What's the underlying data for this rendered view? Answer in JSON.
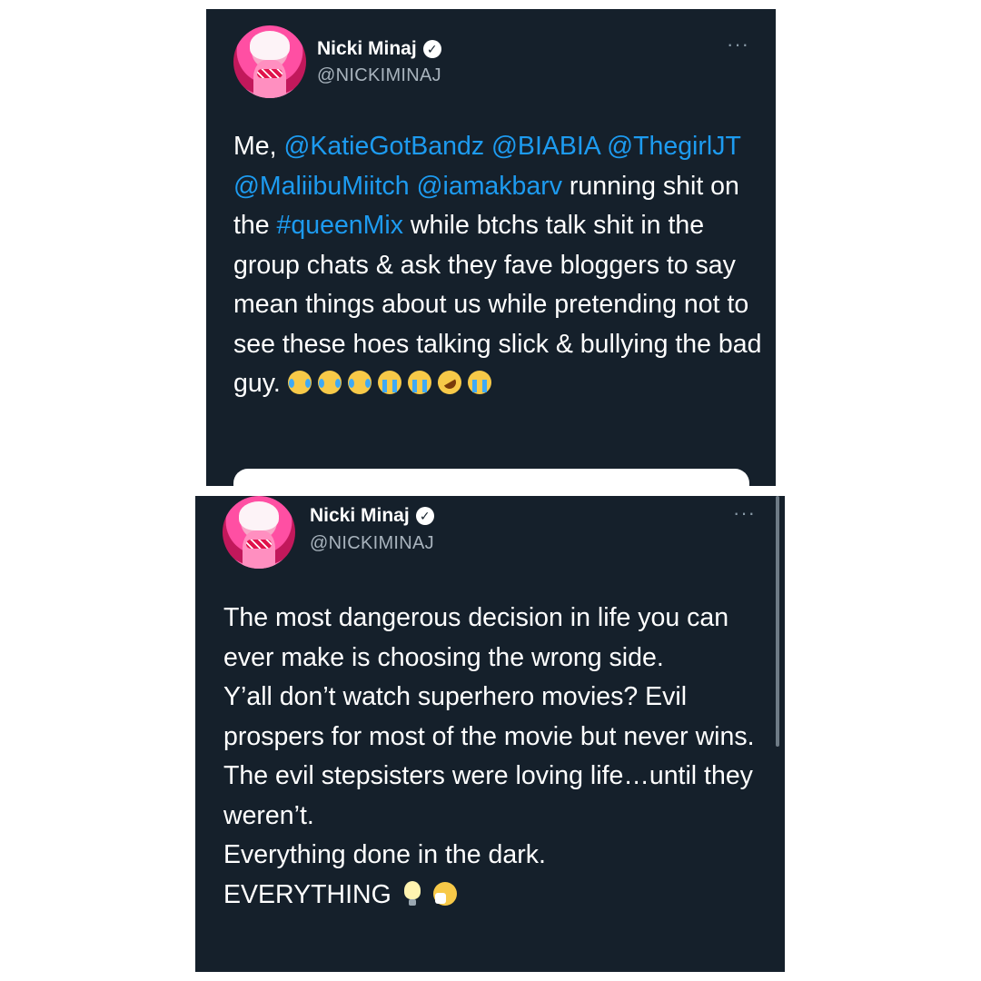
{
  "tweet1": {
    "name": "Nicki Minaj",
    "handle": "@NICKIMINAJ",
    "text_parts": {
      "p0": "Me, ",
      "m1": "@KatieGotBandz",
      "s1": " ",
      "m2": "@BIABIA",
      "s2": " ",
      "m3": "@ThegirlJT",
      "s3": " ",
      "m4": "@MaliibuMiitch",
      "s4": " ",
      "m5": "@iamakbarv",
      "p1": " running shit on the ",
      "hashtag": "#queenMix",
      "p2": " while btchs talk shit in the group chats & ask they fave bloggers to say mean things about us while pretending not to see these hoes talking slick & bullying the bad guy. "
    },
    "emojis": [
      "face-with-tears-of-joy",
      "face-with-tears-of-joy",
      "face-with-tears-of-joy",
      "loudly-crying-face",
      "loudly-crying-face",
      "rolling-on-floor-laughing",
      "loudly-crying-face"
    ]
  },
  "tweet2": {
    "name": "Nicki Minaj",
    "handle": "@NICKIMINAJ",
    "lines": {
      "l1": "The most dangerous decision in life you can ever make is choosing the wrong side.",
      "l2": "Y’all don’t watch superhero movies? Evil prospers for most of the movie but never wins. The evil stepsisters were loving life…until they weren’t.",
      "l3": "Everything done in the dark.",
      "l4": "EVERYTHING"
    },
    "emojis": [
      "light-bulb",
      "sneezing-face"
    ]
  },
  "colors": {
    "background": "#15202b",
    "text": "#ffffff",
    "handle": "#a8b3bd",
    "link": "#1d9bf0"
  },
  "icons": {
    "verified": "verified-badge-icon",
    "more": "more-options-icon"
  }
}
